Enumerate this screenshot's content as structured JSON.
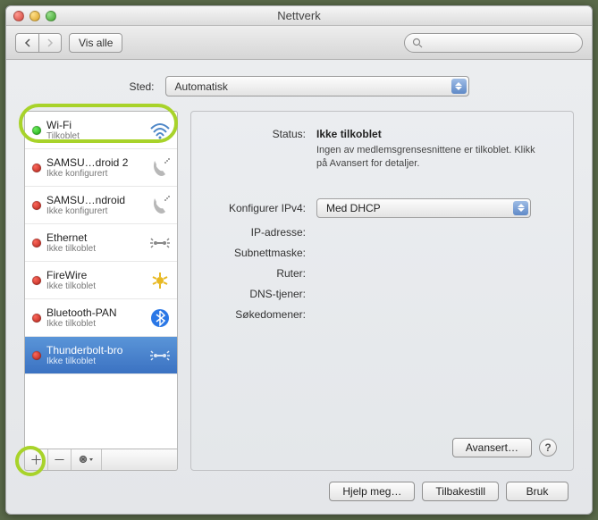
{
  "window": {
    "title": "Nettverk"
  },
  "toolbar": {
    "show_all": "Vis alle"
  },
  "location": {
    "label": "Sted:",
    "value": "Automatisk"
  },
  "sidebar": {
    "items": [
      {
        "name": "Wi-Fi",
        "status": "Tilkoblet",
        "dot": "green",
        "icon": "wifi",
        "selected": false
      },
      {
        "name": "SAMSU…droid 2",
        "status": "Ikke konfigurert",
        "dot": "red",
        "icon": "phone",
        "selected": false
      },
      {
        "name": "SAMSU…ndroid",
        "status": "Ikke konfigurert",
        "dot": "red",
        "icon": "phone",
        "selected": false
      },
      {
        "name": "Ethernet",
        "status": "Ikke tilkoblet",
        "dot": "red",
        "icon": "ethernet",
        "selected": false
      },
      {
        "name": "FireWire",
        "status": "Ikke tilkoblet",
        "dot": "red",
        "icon": "firewire",
        "selected": false
      },
      {
        "name": "Bluetooth-PAN",
        "status": "Ikke tilkoblet",
        "dot": "red",
        "icon": "bluetooth",
        "selected": false
      },
      {
        "name": "Thunderbolt-bro",
        "status": "Ikke tilkoblet",
        "dot": "red",
        "icon": "ethernet",
        "selected": true
      }
    ]
  },
  "detail": {
    "status_label": "Status:",
    "status_value": "Ikke tilkoblet",
    "status_note": "Ingen av medlemsgrensesnittene er tilkoblet. Klikk på Avansert for detaljer.",
    "ipv4_label": "Konfigurer IPv4:",
    "ipv4_value": "Med DHCP",
    "ip_label": "IP-adresse:",
    "subnet_label": "Subnettmaske:",
    "router_label": "Ruter:",
    "dns_label": "DNS-tjener:",
    "search_label": "Søkedomener:",
    "advanced": "Avansert…",
    "help_symbol": "?"
  },
  "buttons": {
    "help_me": "Hjelp meg…",
    "revert": "Tilbakestill",
    "apply": "Bruk"
  }
}
